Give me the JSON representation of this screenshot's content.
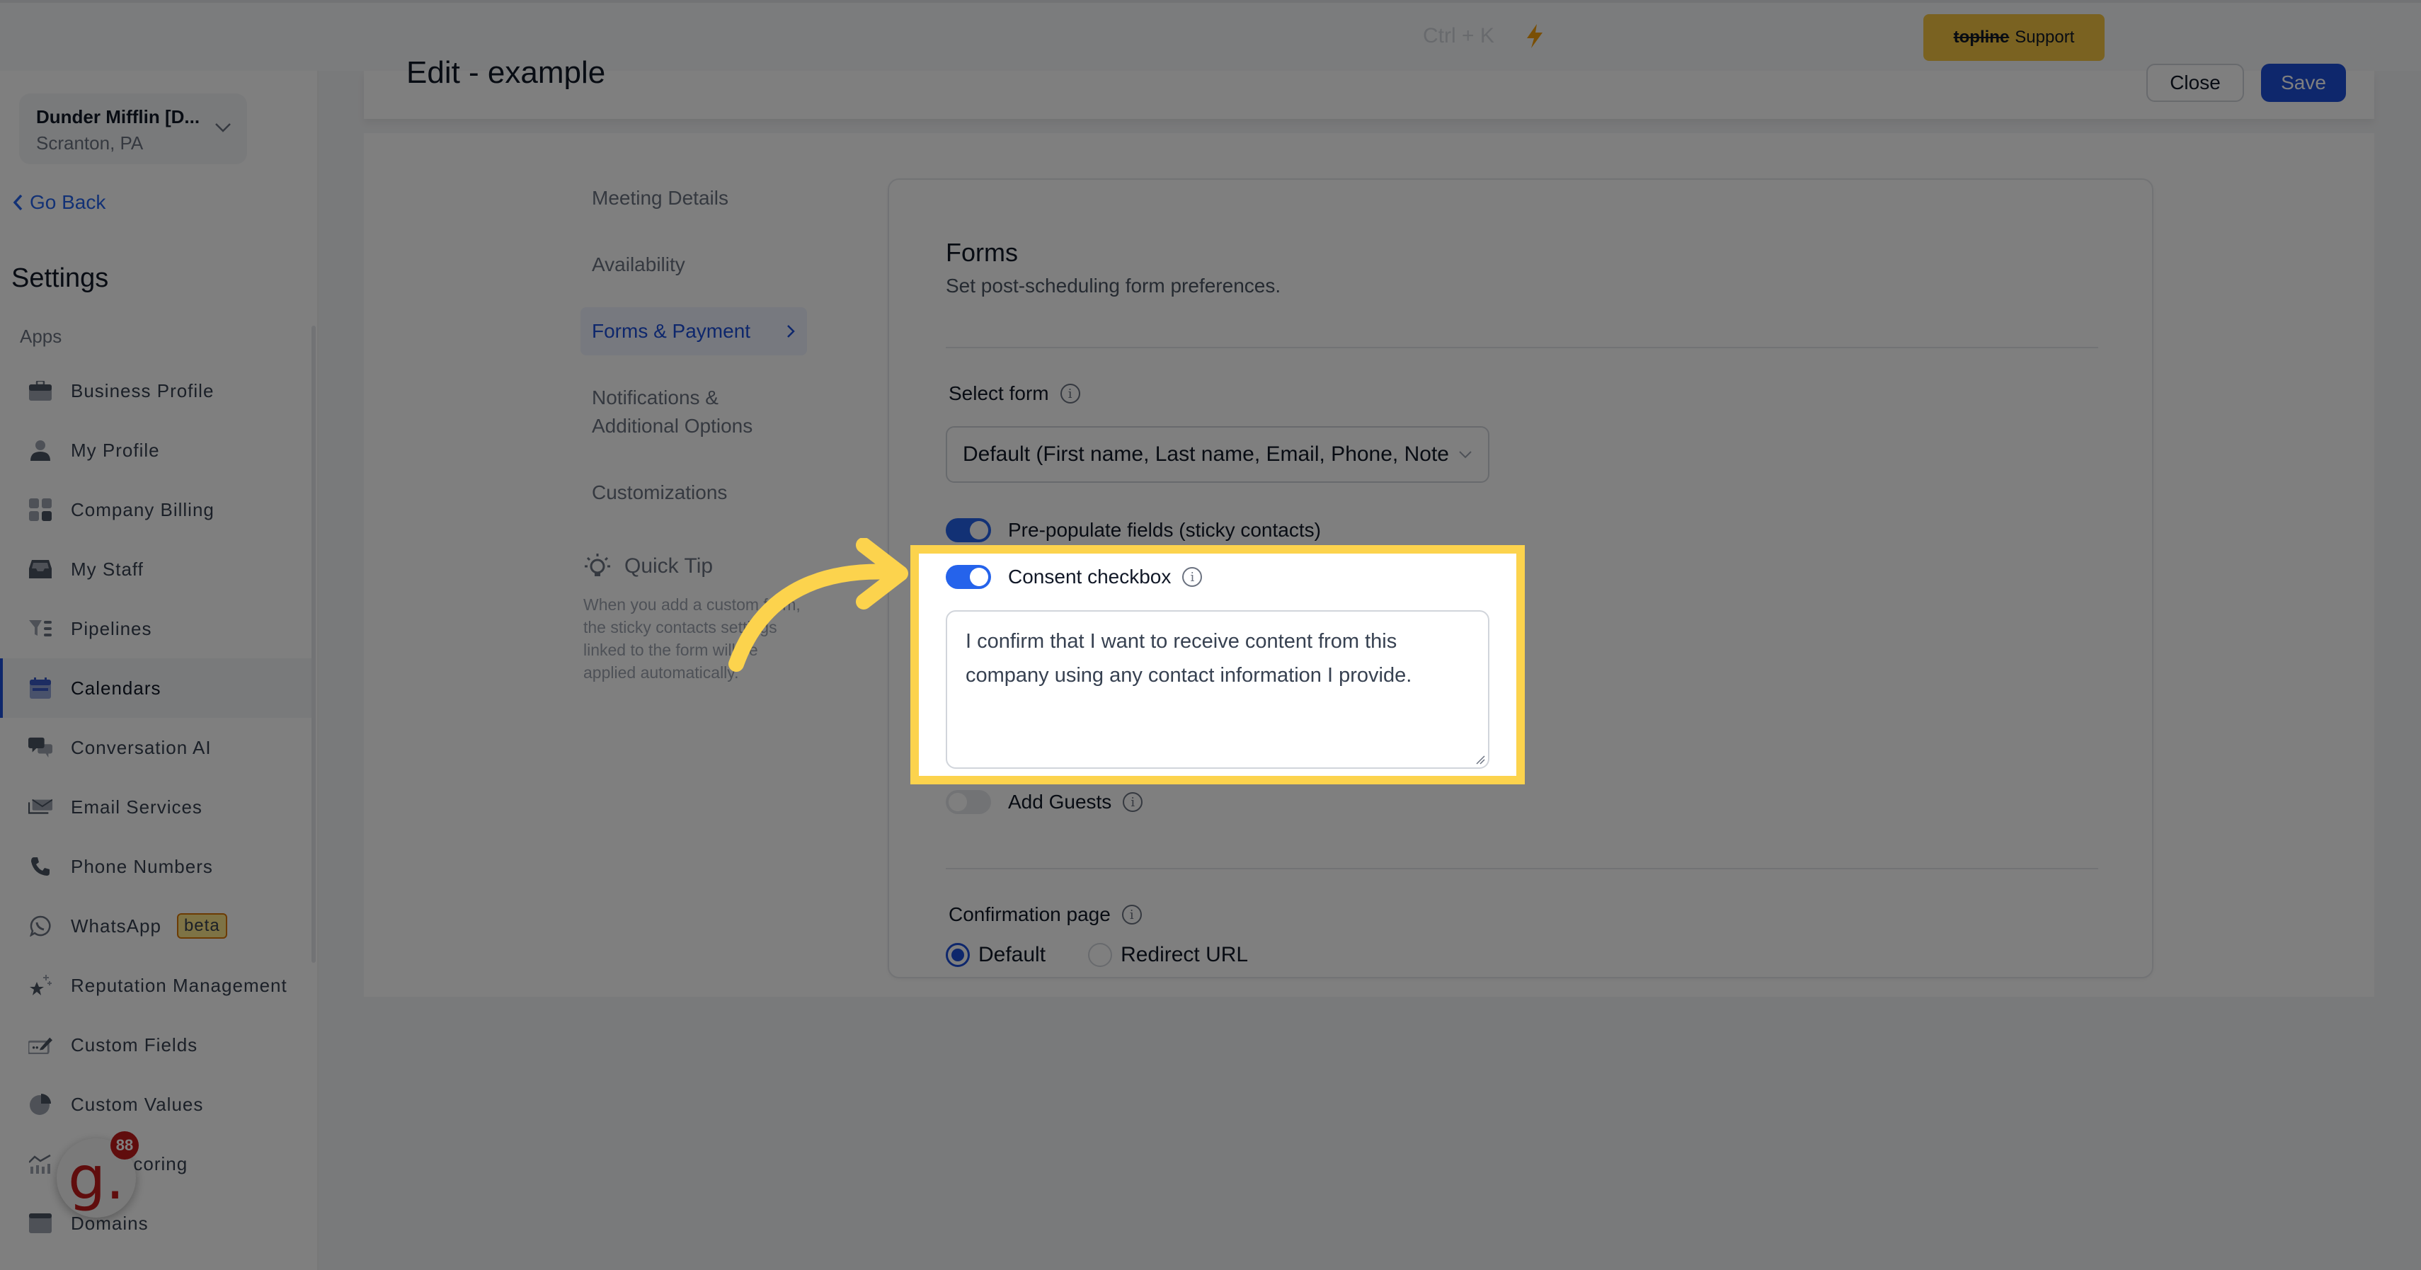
{
  "topbar": {
    "shortcut_hint": "Ctrl + K",
    "support_button": {
      "brand": "topline",
      "label": "Support"
    },
    "accent": "#f5c542"
  },
  "sidebar": {
    "location": {
      "name": "Dunder Mifflin [D...",
      "subtitle": "Scranton, PA"
    },
    "go_back": "Go Back",
    "title": "Settings",
    "section_label": "Apps",
    "items": [
      {
        "label": "Business Profile",
        "icon": "briefcase-icon"
      },
      {
        "label": "My Profile",
        "icon": "user-icon"
      },
      {
        "label": "Company Billing",
        "icon": "calculator-icon"
      },
      {
        "label": "My Staff",
        "icon": "inbox-icon"
      },
      {
        "label": "Pipelines",
        "icon": "funnel-icon"
      },
      {
        "label": "Calendars",
        "icon": "calendar-icon",
        "active": true
      },
      {
        "label": "Conversation AI",
        "icon": "chat-bubbles-icon"
      },
      {
        "label": "Email Services",
        "icon": "envelope-icon"
      },
      {
        "label": "Phone Numbers",
        "icon": "phone-icon"
      },
      {
        "label": "WhatsApp",
        "icon": "whatsapp-icon",
        "badge": "beta"
      },
      {
        "label": "Reputation Management",
        "icon": "star-sparkle-icon"
      },
      {
        "label": "Custom Fields",
        "icon": "edit-field-icon"
      },
      {
        "label": "Custom Values",
        "icon": "pie-chart-icon"
      },
      {
        "label": "Lead Scoring",
        "icon": "chart-bars-icon",
        "visible_text": "e Scoring"
      },
      {
        "label": "Domains",
        "icon": "browser-window-icon"
      }
    ],
    "floating_badge": {
      "letter": "g.",
      "count": "88"
    }
  },
  "header": {
    "title": "Edit - example",
    "close_label": "Close",
    "save_label": "Save"
  },
  "subnav": {
    "items": [
      {
        "label": "Meeting Details"
      },
      {
        "label": "Availability"
      },
      {
        "label": "Forms & Payment",
        "active": true
      },
      {
        "label": "Notifications & Additional Options"
      },
      {
        "label": "Customizations"
      }
    ]
  },
  "quick_tip": {
    "title": "Quick Tip",
    "body": "When you add a custom form, the sticky contacts settings linked to the form will be applied automatically."
  },
  "forms": {
    "title": "Forms",
    "subtitle": "Set post-scheduling form preferences.",
    "select_form_label": "Select form",
    "select_form_value": "Default (First name, Last name, Email, Phone, Note",
    "prepopulate": {
      "label": "Pre-populate fields (sticky contacts)",
      "on": true
    },
    "consent": {
      "label": "Consent checkbox",
      "on": true,
      "text": "I confirm that I want to receive content from this company using any contact information I provide."
    },
    "add_guests": {
      "label": "Add Guests",
      "on": false
    },
    "confirmation_page": {
      "label": "Confirmation page",
      "options": [
        {
          "label": "Default",
          "checked": true
        },
        {
          "label": "Redirect URL",
          "checked": false
        }
      ]
    }
  },
  "annotation": {
    "highlight_color": "#fcd34d",
    "target": "Consent checkbox"
  }
}
